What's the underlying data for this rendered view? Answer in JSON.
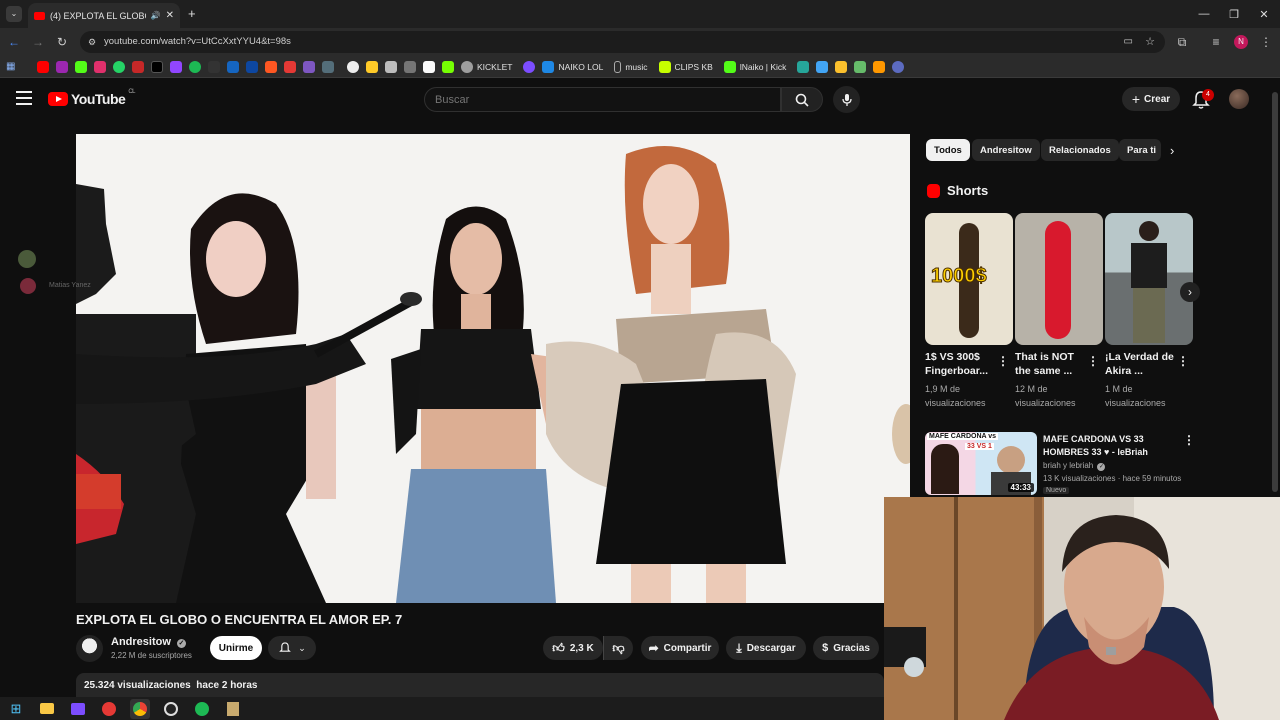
{
  "browser": {
    "tab_title": "(4) EXPLOTA EL GLOBO O EN",
    "url": "youtube.com/watch?v=UtCcXxtYYU4&t=98s",
    "bookmarks_named": [
      "KICKLET",
      "NAIKO LOL",
      "music",
      "CLIPS KB",
      "lNaiko | Kick"
    ]
  },
  "youtube": {
    "logo_text": "YouTube",
    "logo_region": "CL",
    "search_placeholder": "Buscar",
    "create_label": "Crear",
    "notif_count": "4"
  },
  "video": {
    "title": "EXPLOTA EL GLOBO O ENCUENTRA EL AMOR EP. 7",
    "channel": "Andresitow",
    "subscribers": "2,22 M de suscriptores",
    "join_label": "Unirme",
    "likes": "2,3 K",
    "share_label": "Compartir",
    "download_label": "Descargar",
    "thanks_label": "Gracias",
    "views": "25.324 visualizaciones",
    "age": "hace 2 horas"
  },
  "chips": [
    "Todos",
    "Andresitow",
    "Relacionados",
    "Para ti"
  ],
  "shorts": {
    "heading": "Shorts",
    "items": [
      {
        "title": "1$ VS 300$ Fingerboar...",
        "views": "1,9 M de visualizaciones",
        "thumb_text": "1000$"
      },
      {
        "title": "That is NOT the same ...",
        "views": "12 M de visualizaciones"
      },
      {
        "title": "¡La Verdad de Akira ...",
        "views": "1 M de visualizaciones"
      }
    ]
  },
  "recommended": {
    "title_line1": "MAFE CARDONA VS 33",
    "title_line2": "HOMBRES 33 ♥ - leBriah",
    "channel": "briah y lebriah",
    "meta": "13 K visualizaciones · hace 59 minutos",
    "badge": "Nuevo",
    "duration": "43:33",
    "thumb_header": "MAFE CARDONA vs",
    "thumb_sub": "33 VS 1"
  },
  "chat_overlay": {
    "user": "Matias Yanez"
  }
}
